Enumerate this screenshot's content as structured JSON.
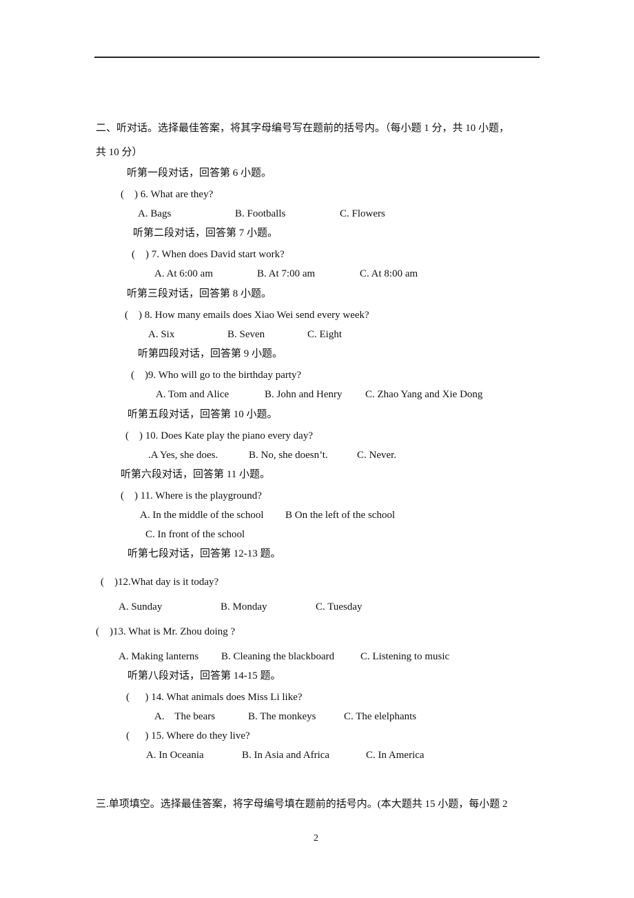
{
  "section2": {
    "heading_line1": "二、听对话。选择最佳答案，将其字母编号写在题前的括号内。（每小题 1 分，共 10 小题，",
    "heading_line2": "共 10 分）"
  },
  "items": [
    {
      "type": "instruction",
      "text": "听第一段对话，回答第 6 小题。"
    },
    {
      "type": "question",
      "text": "(    ) 6. What are they?",
      "options": [
        "A. Bags",
        "B. Footballs",
        "C. Flowers"
      ]
    },
    {
      "type": "instruction",
      "text": "听第二段对话，回答第 7 小题。"
    },
    {
      "type": "question",
      "text": "(    ) 7. When does David start work?",
      "options": [
        "A. At 6:00 am",
        "B. At 7:00 am",
        "C. At 8:00 am"
      ]
    },
    {
      "type": "instruction",
      "text": "听第三段对话，回答第 8 小题。"
    },
    {
      "type": "question",
      "text": "(    ) 8. How many emails does Xiao Wei send every week?",
      "options": [
        "A. Six",
        "B. Seven",
        "C. Eight"
      ]
    },
    {
      "type": "instruction",
      "text": "听第四段对话，回答第 9 小题。"
    },
    {
      "type": "question",
      "text": "(    )9. Who will go to the birthday party?",
      "options": [
        "A. Tom and Alice",
        "B. John and Henry",
        "C. Zhao Yang and Xie Dong"
      ]
    },
    {
      "type": "instruction",
      "text": "听第五段对话，回答第 10 小题。"
    },
    {
      "type": "question",
      "text": "(    ) 10. Does Kate play the piano every day?",
      "options": [
        ".A Yes, she does.",
        "B. No, she doesn’t.",
        "C. Never."
      ]
    },
    {
      "type": "instruction",
      "text": "听第六段对话，回答第 11 小题。"
    },
    {
      "type": "question",
      "text": "(    ) 11. Where is the playground?",
      "options": [
        "A. In the middle of the school",
        "B On the left of the school",
        "C. In front of the school"
      ]
    },
    {
      "type": "instruction",
      "text": "听第七段对话，回答第 12-13 题。"
    },
    {
      "type": "question",
      "text": "(    )12.What day is it today?",
      "options": [
        "A. Sunday",
        "B. Monday",
        "C. Tuesday"
      ]
    },
    {
      "type": "question",
      "text": "(    )13. What is Mr. Zhou doing ?",
      "options": [
        "A. Making lanterns",
        "B. Cleaning the blackboard",
        "C. Listening to music"
      ]
    },
    {
      "type": "instruction",
      "text": "听第八段对话，回答第 14-15 题。"
    },
    {
      "type": "question",
      "text": "(      ) 14. What animals does Miss Li like?",
      "options": [
        "A.    The bears",
        "B. The monkeys",
        "C. The elelphants"
      ]
    },
    {
      "type": "question",
      "text": "(      ) 15. Where do they live?",
      "options": [
        "A. In Oceania",
        "B. In Asia and Africa",
        "C. In America"
      ]
    }
  ],
  "section3": {
    "heading": "三.单项填空。选择最佳答案，将字母编号填在题前的括号内。(本大题共 15 小题，每小题 2"
  },
  "page_number": "2"
}
